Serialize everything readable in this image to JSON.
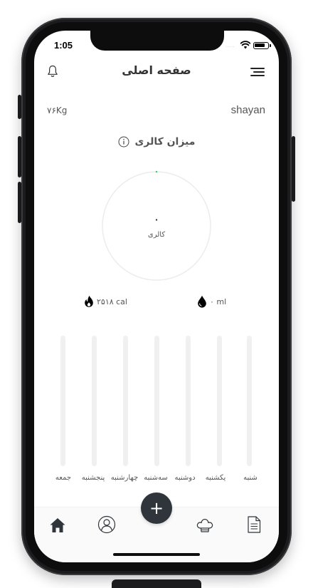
{
  "status_bar": {
    "time": "1:05",
    "dots": "....."
  },
  "header": {
    "title": "صفحه اصلی"
  },
  "profile": {
    "weight": "۷۶Kg",
    "username": "shayan"
  },
  "calorie_section": {
    "title": "میزان کالری"
  },
  "gauge": {
    "value": "۰",
    "label": "کالری",
    "progress": 0
  },
  "stats": {
    "calories": "۲۵۱۸ cal",
    "water": "۰ ml"
  },
  "week": {
    "days": [
      "جمعه",
      "پنجشنبه",
      "چهارشنبه",
      "سه‌شنبه",
      "دوشنبه",
      "یکشنبه",
      "شنبه"
    ],
    "levels": [
      0,
      0,
      0,
      0,
      0,
      0,
      0
    ]
  },
  "tabbar": {
    "items": [
      "home-icon",
      "profile-icon",
      "add-icon",
      "chef-hat-icon",
      "document-icon"
    ],
    "add_label": "+"
  },
  "colors": {
    "accent": "#2f353b",
    "track": "#f0f0f0",
    "gauge_dot": "#2ecc71"
  }
}
